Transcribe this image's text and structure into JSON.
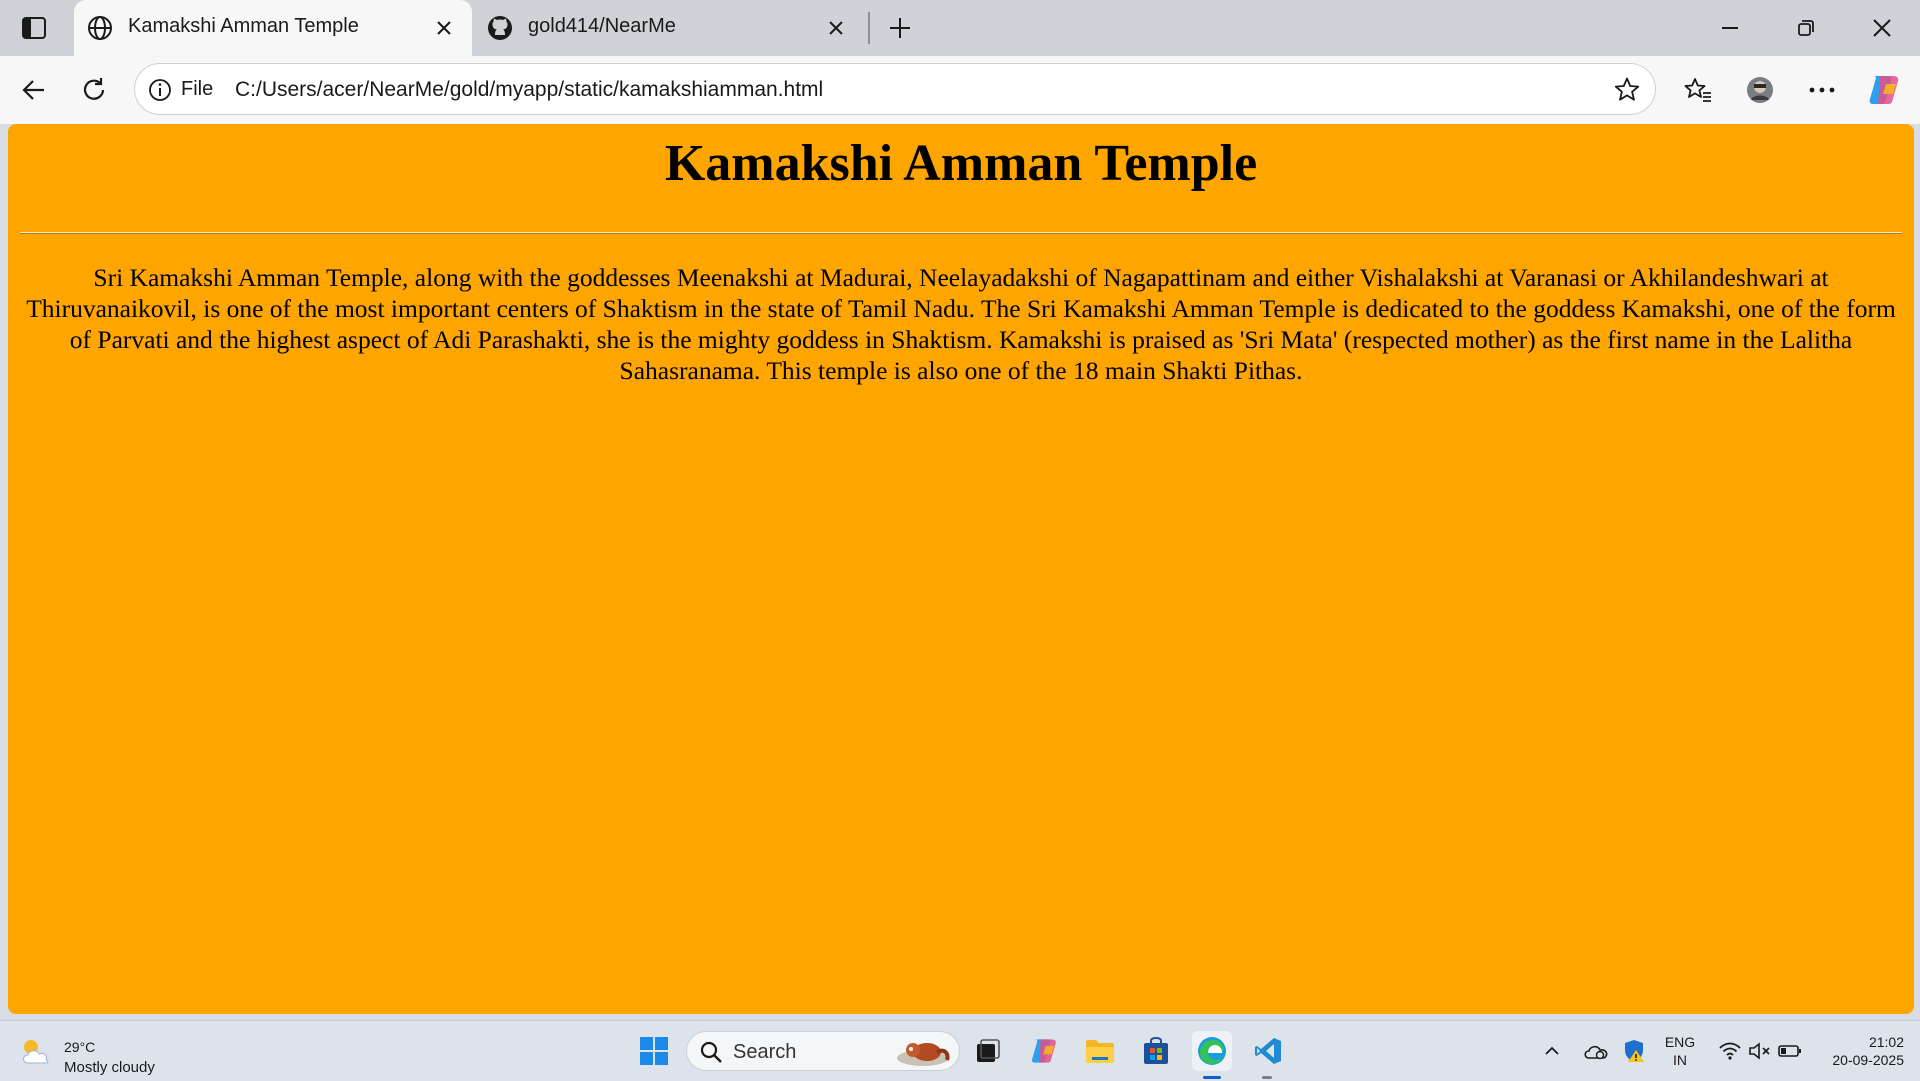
{
  "browser": {
    "tabs": [
      {
        "title": "Kamakshi Amman Temple",
        "favicon": "globe-icon",
        "active": true
      },
      {
        "title": "gold414/NearMe",
        "favicon": "github-icon",
        "active": false
      }
    ],
    "address_bar": {
      "scheme_label": "File",
      "url": "C:/Users/acer/NearMe/gold/myapp/static/kamakshiamman.html"
    }
  },
  "page": {
    "background_color": "#ffa500",
    "heading": "Kamakshi Amman Temple",
    "paragraph": "Sri Kamakshi Amman Temple, along with the goddesses Meenakshi at Madurai, Neelayadakshi of Nagapattinam and either Vishalakshi at Varanasi or Akhilandeshwari at Thiruvanaikovil, is one of the most important centers of Shaktism in the state of Tamil Nadu. The Sri Kamakshi Amman Temple is dedicated to the goddess Kamakshi, one of the form of Parvati and the highest aspect of Adi Parashakti, she is the mighty goddess in Shaktism. Kamakshi is praised as 'Sri Mata' (respected mother) as the first name in the Lalitha Sahasranama. This temple is also one of the 18 main Shakti Pithas."
  },
  "taskbar": {
    "weather": {
      "temperature": "29°C",
      "condition": "Mostly cloudy"
    },
    "search_label": "Search",
    "tray": {
      "language_line1": "ENG",
      "language_line2": "IN",
      "time": "21:02",
      "date": "20-09-2025"
    }
  }
}
